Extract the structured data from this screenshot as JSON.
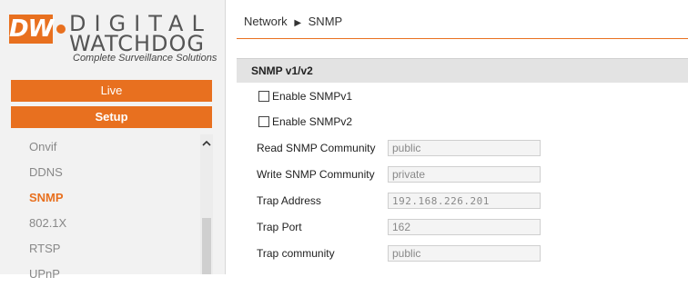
{
  "brand": {
    "logo_box": "DW",
    "logo_line1": "DIGITAL",
    "logo_line2": "WATCHDOG",
    "tagline": "Complete Surveillance Solutions",
    "accent_color": "#e8701f"
  },
  "nav": {
    "live_label": "Live",
    "setup_label": "Setup"
  },
  "sidebar": {
    "items": [
      {
        "label": "Onvif",
        "active": false
      },
      {
        "label": "DDNS",
        "active": false
      },
      {
        "label": "SNMP",
        "active": true
      },
      {
        "label": "802.1X",
        "active": false
      },
      {
        "label": "RTSP",
        "active": false
      },
      {
        "label": "UPnP",
        "active": false
      }
    ]
  },
  "breadcrumb": {
    "parent": "Network",
    "separator": "▶",
    "current": "SNMP"
  },
  "section": {
    "title": "SNMP v1/v2",
    "enable_v1_label": "Enable SNMPv1",
    "enable_v2_label": "Enable SNMPv2",
    "enable_v1_checked": false,
    "enable_v2_checked": false
  },
  "fields": {
    "read_community": {
      "label": "Read SNMP Community",
      "value": "public"
    },
    "write_community": {
      "label": "Write SNMP Community",
      "value": "private"
    },
    "trap_address": {
      "label": "Trap Address",
      "value": "192.168.226.201"
    },
    "trap_port": {
      "label": "Trap Port",
      "value": "162"
    },
    "trap_community": {
      "label": "Trap community",
      "value": "public"
    }
  }
}
